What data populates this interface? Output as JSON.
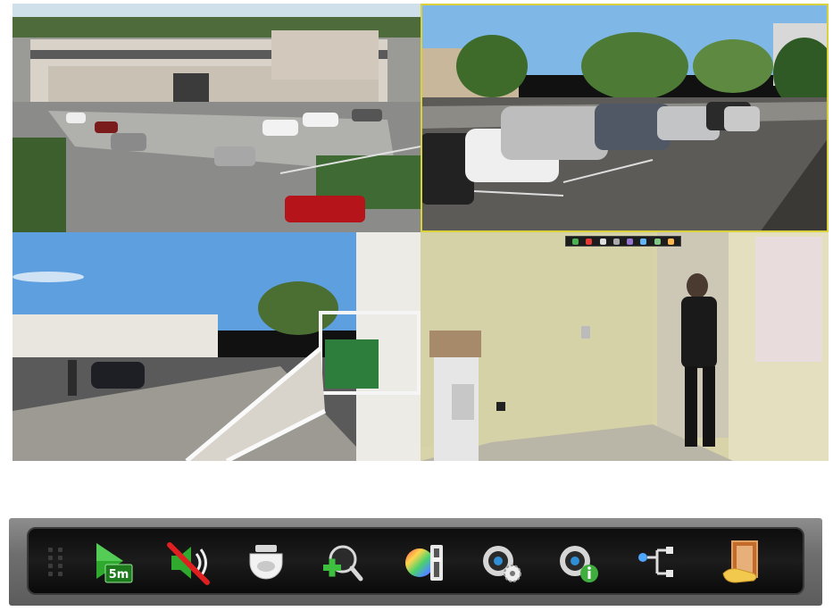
{
  "cameras": [
    {
      "id": "cam-1",
      "scene": "parking-lot-aerial"
    },
    {
      "id": "cam-2",
      "scene": "parking-lot-cars",
      "selected": true
    },
    {
      "id": "cam-3",
      "scene": "lot-with-stairs"
    },
    {
      "id": "cam-4",
      "scene": "indoor-hallway"
    }
  ],
  "colors": {
    "selection_border": "#d9d23a",
    "toolbar_bg": "#111111",
    "toolbar_frame": "#6f6f6f"
  },
  "toolbar": {
    "playback_label": "5m",
    "buttons": [
      {
        "icon": "playback-icon"
      },
      {
        "icon": "mute-icon"
      },
      {
        "icon": "ptz-dome-camera-icon"
      },
      {
        "icon": "digital-zoom-icon"
      },
      {
        "icon": "image-color-adjust-icon"
      },
      {
        "icon": "camera-settings-icon"
      },
      {
        "icon": "camera-info-icon"
      },
      {
        "icon": "channel-switch-icon"
      },
      {
        "icon": "exit-icon"
      }
    ]
  }
}
